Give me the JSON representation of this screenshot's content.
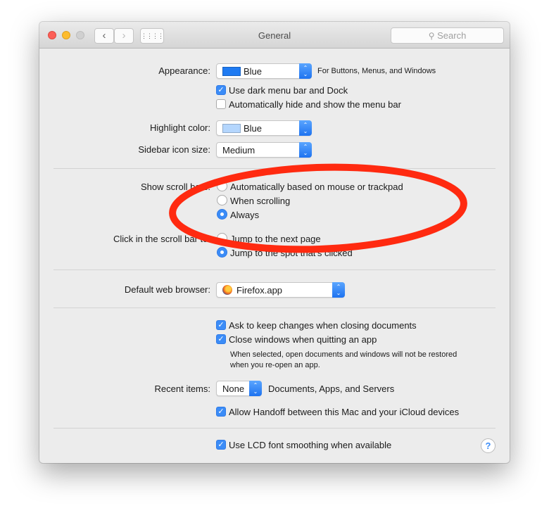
{
  "window": {
    "title": "General",
    "search_placeholder": "Search"
  },
  "appearance": {
    "label": "Appearance:",
    "value": "Blue",
    "hint": "For Buttons, Menus, and Windows",
    "swatch_color": "#1f7bf2"
  },
  "dark_menu": {
    "label": "Use dark menu bar and Dock",
    "checked": true
  },
  "auto_hide": {
    "label": "Automatically hide and show the menu bar",
    "checked": false
  },
  "highlight": {
    "label": "Highlight color:",
    "value": "Blue",
    "swatch_color": "#b4d6fd"
  },
  "sidebar_size": {
    "label": "Sidebar icon size:",
    "value": "Medium"
  },
  "scroll_bars": {
    "label": "Show scroll bars:",
    "options": [
      "Automatically based on mouse or trackpad",
      "When scrolling",
      "Always"
    ],
    "selected": "Always"
  },
  "scroll_click": {
    "label": "Click in the scroll bar to:",
    "options": [
      "Jump to the next page",
      "Jump to the spot that's clicked"
    ],
    "selected": "Jump to the spot that's clicked"
  },
  "browser": {
    "label": "Default web browser:",
    "value": "Firefox.app"
  },
  "ask_keep": {
    "label": "Ask to keep changes when closing documents",
    "checked": true
  },
  "close_windows": {
    "label": "Close windows when quitting an app",
    "checked": true,
    "note1": "When selected, open documents and windows will not be restored",
    "note2": "when you re-open an app."
  },
  "recent": {
    "label": "Recent items:",
    "value": "None",
    "hint": "Documents, Apps, and Servers"
  },
  "handoff": {
    "label": "Allow Handoff between this Mac and your iCloud devices",
    "checked": true
  },
  "lcd": {
    "label": "Use LCD font smoothing when available",
    "checked": true
  },
  "help": "?",
  "annotation_color": "#ff2a10"
}
